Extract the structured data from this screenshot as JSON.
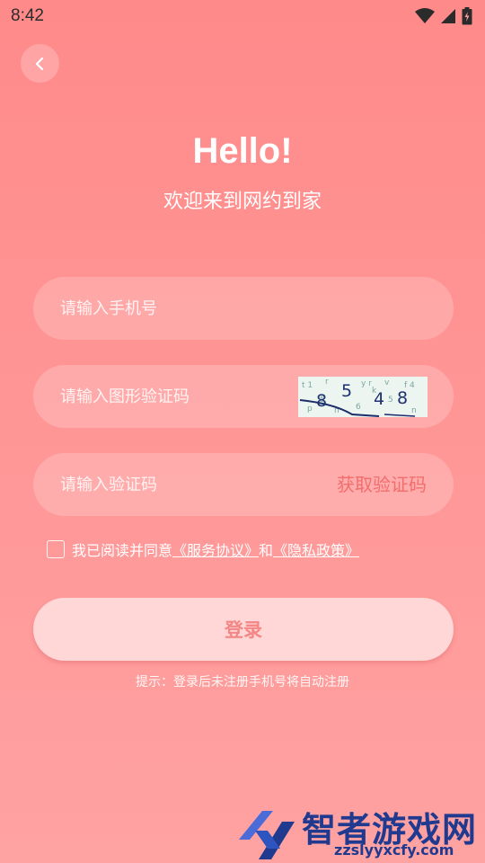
{
  "status_bar": {
    "time": "8:42"
  },
  "header": {
    "title": "Hello!",
    "subtitle": "欢迎来到网约到家"
  },
  "form": {
    "phone": {
      "placeholder": "请输入手机号",
      "value": ""
    },
    "captcha": {
      "placeholder": "请输入图形验证码",
      "value": "",
      "image_text": "8548"
    },
    "sms_code": {
      "placeholder": "请输入验证码",
      "value": "",
      "action_label": "获取验证码"
    }
  },
  "agreement": {
    "checked": false,
    "prefix": "我已阅读并同意",
    "service_link": "《服务协议》",
    "and": "和",
    "privacy_link": "《隐私政策》"
  },
  "login_button": {
    "label": "登录"
  },
  "hint": "提示：登录后未注册手机号将自动注册",
  "watermark": {
    "name": "智者游戏网",
    "url": "zzslyyxcfy.com"
  },
  "colors": {
    "background": "#ff8f8f",
    "accent": "#f46d6d",
    "button_bg": "#ffd7d6"
  }
}
